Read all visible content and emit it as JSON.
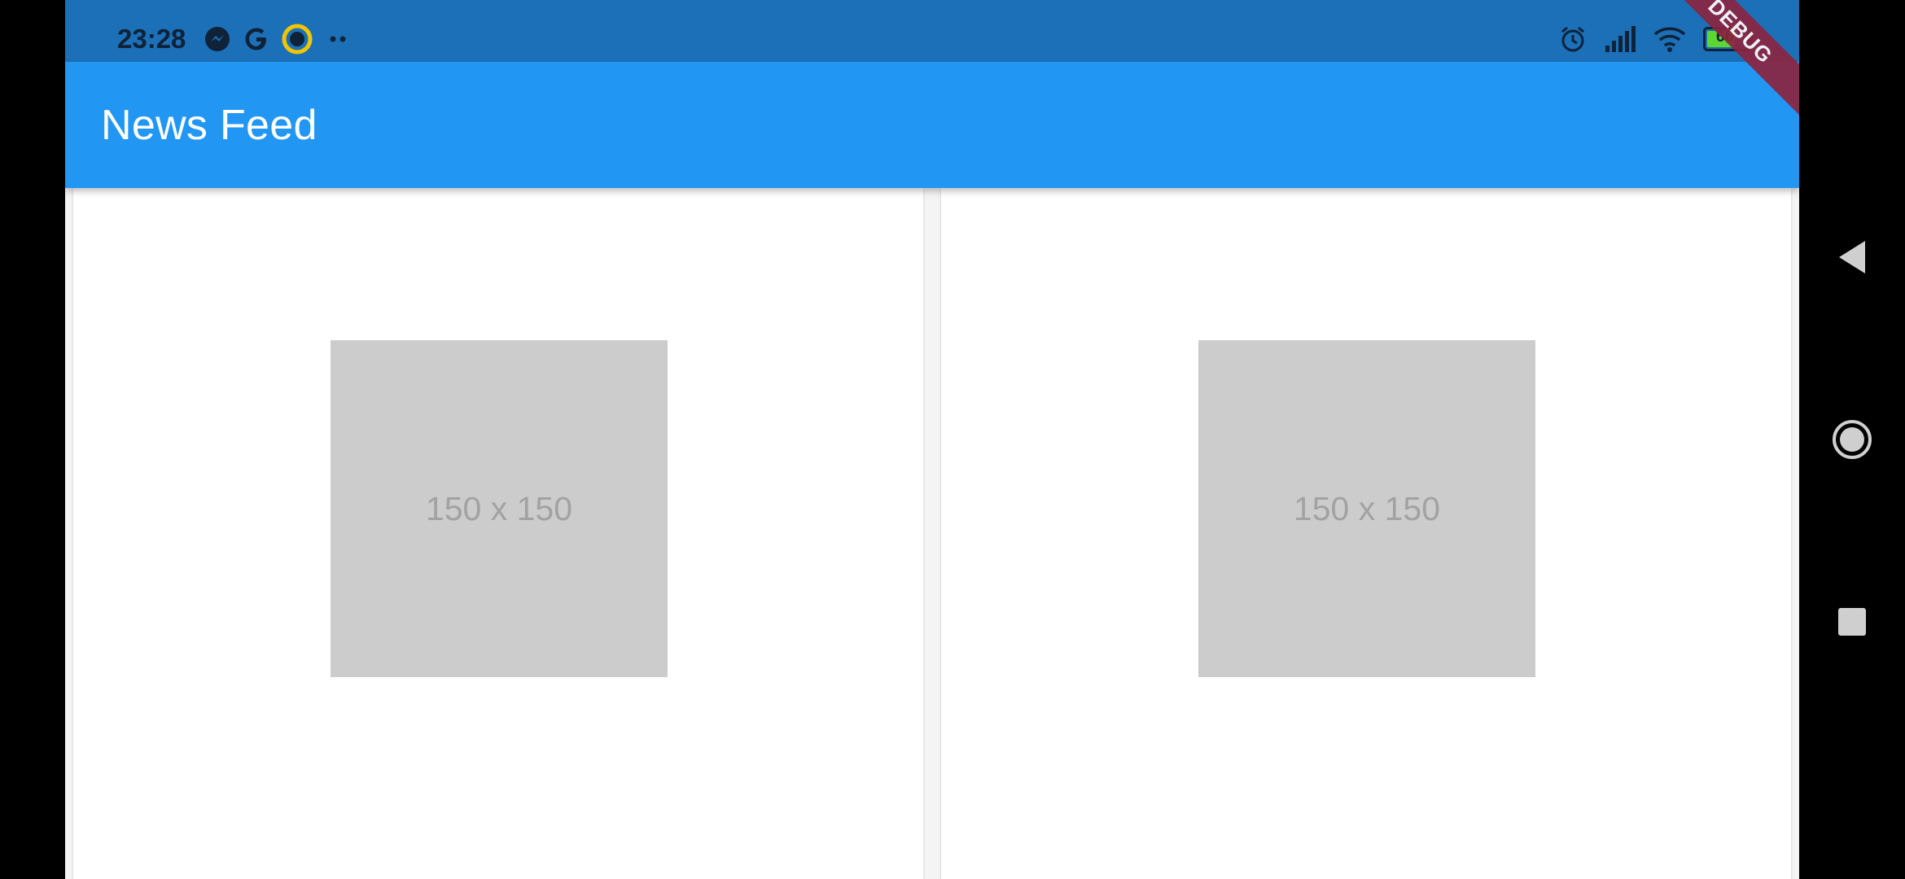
{
  "status_bar": {
    "time": "23:28",
    "left_icons": [
      "messenger-icon",
      "google-icon",
      "vpn-icon",
      "more-dots-icon"
    ],
    "right_icons": [
      "alarm-icon",
      "signal-icon",
      "wifi-icon",
      "battery-icon"
    ],
    "battery_level": "66"
  },
  "app_bar": {
    "title": "News Feed",
    "debug_banner": "DEBUG"
  },
  "feed": {
    "cards": [
      {
        "image_label": "150 x 150"
      },
      {
        "image_label": "150 x 150"
      }
    ]
  },
  "nav_bar": {
    "buttons": [
      "back-icon",
      "home-icon",
      "recents-icon"
    ]
  },
  "colors": {
    "status_bar": "#1c70b8",
    "app_bar": "#2196f3",
    "placeholder": "#cccccc"
  }
}
